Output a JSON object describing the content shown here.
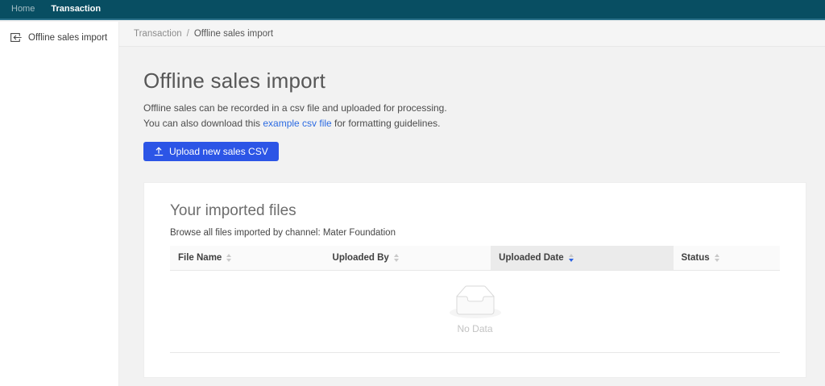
{
  "topnav": {
    "items": [
      {
        "label": "Home",
        "active": false
      },
      {
        "label": "Transaction",
        "active": true
      }
    ]
  },
  "sidebar": {
    "items": [
      {
        "label": "Offline sales import",
        "icon": "import-icon"
      }
    ]
  },
  "breadcrumb": {
    "separator": "/",
    "items": [
      "Transaction",
      "Offline sales import"
    ]
  },
  "page": {
    "title": "Offline sales import",
    "description_line1": "Offline sales can be recorded in a csv file and uploaded for processing.",
    "description_line2_prefix": "You can also download this ",
    "description_link": "example csv file",
    "description_line2_suffix": " for formatting guidelines.",
    "upload_button": "Upload new sales CSV"
  },
  "card": {
    "title": "Your imported files",
    "subtitle": "Browse all files imported by channel: Mater Foundation",
    "table": {
      "columns": [
        {
          "label": "File Name",
          "sorted": null
        },
        {
          "label": "Uploaded By",
          "sorted": null
        },
        {
          "label": "Uploaded Date",
          "sorted": "desc"
        },
        {
          "label": "Status",
          "sorted": null
        }
      ],
      "rows": [],
      "empty_text": "No Data"
    }
  },
  "icons": {
    "sidebar": "import-icon",
    "button": "upload-icon",
    "sort": "caret-up-down-icon",
    "empty": "empty-inbox-icon"
  },
  "colors": {
    "navbar_bg": "#084e62",
    "navbar_border": "#2a7089",
    "accent_button_blue": "#2c55e6",
    "link_blue": "#2c6be2",
    "sorted_caret_blue": "#2b62e3",
    "page_bg": "#f2f2f2",
    "sorted_header_bg": "#ebebeb",
    "header_bg": "#fafafa"
  }
}
